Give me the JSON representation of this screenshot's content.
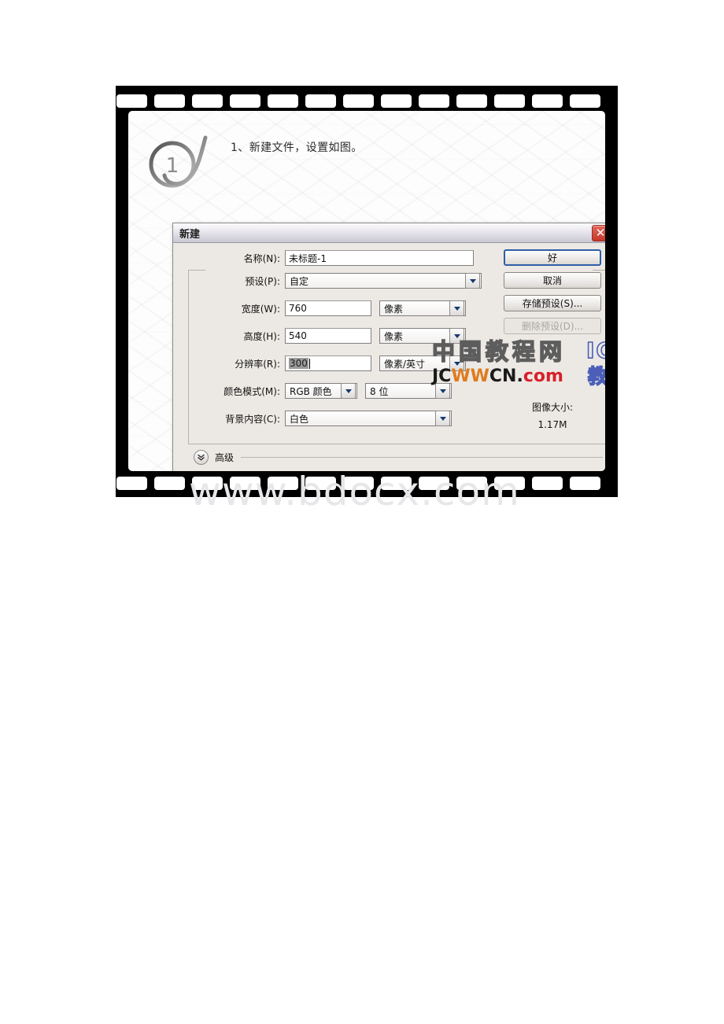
{
  "page": {
    "background_watermark": "www.bdocx.com"
  },
  "tutorial": {
    "step_number": "1",
    "instruction": "1、新建文件，设置如图。"
  },
  "site_watermark": {
    "chinese": "中国教程网",
    "url_part1": "JC",
    "url_part2": "WW",
    "url_part3": "CN.",
    "url_part4": "com",
    "ice": "ICE",
    "ice_sub": "教程"
  },
  "dialog": {
    "title": "新建",
    "close_label": "✕",
    "name_label": "名称(N):",
    "name_value": "未标题-1",
    "preset_label": "预设(P):",
    "preset_value": "自定",
    "rows": [
      {
        "label": "宽度(W):",
        "value": "760",
        "unit": "像素"
      },
      {
        "label": "高度(H):",
        "value": "540",
        "unit": "像素"
      },
      {
        "label": "分辨率(R):",
        "value": "300",
        "unit": "像素/英寸"
      }
    ],
    "color_mode_label": "颜色模式(M):",
    "color_mode_value": "RGB 颜色",
    "bit_depth_value": "8 位",
    "background_label": "背景内容(C):",
    "background_value": "白色",
    "advanced_label": "高级",
    "buttons": {
      "ok": "好",
      "cancel": "取消",
      "save_preset": "存储预设(S)...",
      "delete_preset": "删除预设(D)..."
    },
    "image_size_label": "图像大小:",
    "image_size_value": "1.17M"
  },
  "colors": {
    "dialog_face": "#ece9e4",
    "default_button_border": "#2d5fa6",
    "close_button": "#c6372b"
  }
}
